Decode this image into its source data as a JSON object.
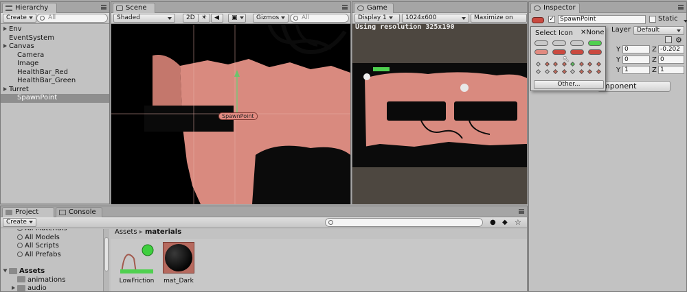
{
  "hierarchy": {
    "tab_label": "Hierarchy",
    "create_label": "Create",
    "search_placeholder": "All",
    "items": [
      {
        "label": "Env",
        "expandable": true
      },
      {
        "label": "EventSystem",
        "expandable": false
      },
      {
        "label": "Canvas",
        "expandable": true
      },
      {
        "label": "Camera",
        "expandable": false
      },
      {
        "label": "Image",
        "expandable": false
      },
      {
        "label": "HealthBar_Red",
        "expandable": false
      },
      {
        "label": "HealthBar_Green",
        "expandable": false
      },
      {
        "label": "Turret",
        "expandable": true
      },
      {
        "label": "SpawnPoint",
        "expandable": false,
        "selected": true
      }
    ]
  },
  "scene": {
    "tab_label": "Scene",
    "shading_mode": "Shaded",
    "mode_2d": "2D",
    "gizmos_label": "Gizmos",
    "search_placeholder": "All",
    "object_label": "SpawnPoint"
  },
  "game": {
    "tab_label": "Game",
    "display": "Display 1",
    "resolution": "1024x600",
    "maximize_label": "Maximize on",
    "resolution_notice": "Using resolution 325x190"
  },
  "inspector": {
    "tab_label": "Inspector",
    "object_name": "SpawnPoint",
    "static_label": "Static",
    "layer_label": "Layer",
    "layer_value": "Default",
    "position": {
      "y": "0",
      "z": "-0.202"
    },
    "rotation": {
      "y": "0",
      "z": "0"
    },
    "scale": {
      "y": "1",
      "z": "1"
    },
    "add_component_label": "mponent"
  },
  "icon_picker": {
    "title": "Select Icon",
    "none_label": "None",
    "other_label": "Other...",
    "pill_colors_row1": [
      "#c8c8c8",
      "#c8c8c8",
      "#c8c8c8",
      "#4fd04f"
    ],
    "pill_colors_row2": [
      "#e08a80",
      "#c94a40",
      "#c94a40",
      "#c94a40"
    ],
    "diamond_colors": [
      "#c8c8c8",
      "#c96a5a",
      "#c96a5a",
      "#c96a5a",
      "#5bbf5b",
      "#c96a5a",
      "#c96a5a",
      "#c96a5a",
      "#c8c8c8",
      "#c8c8c8",
      "#c96a5a",
      "#c96a5a",
      "#c8c8c8",
      "#c96a5a",
      "#c96a5a",
      "#c96a5a"
    ]
  },
  "project": {
    "tab_label": "Project",
    "console_tab_label": "Console",
    "create_label": "Create",
    "favorites": [
      "All Materials",
      "All Models",
      "All Scripts",
      "All Prefabs"
    ],
    "assets_label": "Assets",
    "asset_folders": [
      "animations",
      "audio"
    ],
    "breadcrumb_root": "Assets",
    "breadcrumb_current": "materials",
    "assets": [
      {
        "name": "LowFriction",
        "icon": "physics-material-icon"
      },
      {
        "name": "mat_Dark",
        "icon": "material-sphere-icon"
      }
    ]
  },
  "colors": {
    "scene_pink": "#d98a7f",
    "healthbar_green": "#4fd04f",
    "selection_gray": "#8e8e8e"
  }
}
